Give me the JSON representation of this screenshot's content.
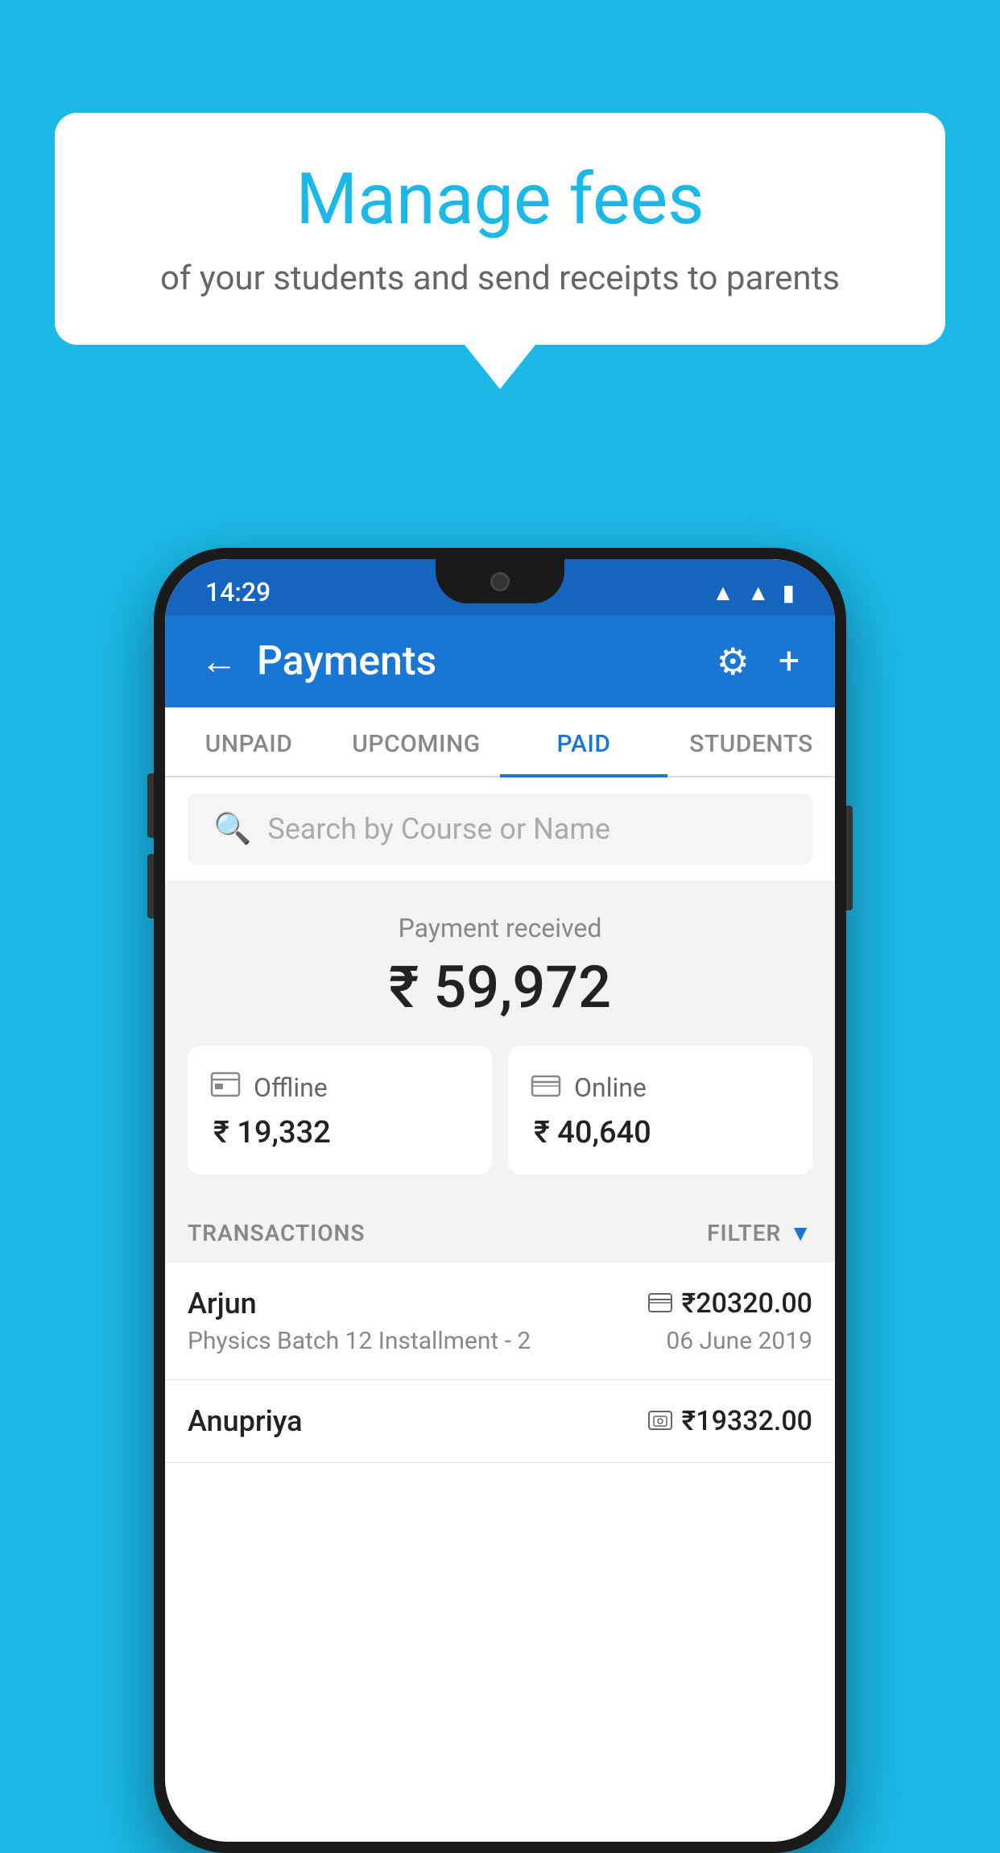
{
  "background_color": "#1BB8E8",
  "speech_bubble": {
    "title": "Manage fees",
    "subtitle": "of your students and send receipts to parents"
  },
  "status_bar": {
    "time": "14:29",
    "wifi_icon": "▲",
    "signal_icon": "▲",
    "battery_icon": "▮"
  },
  "app_bar": {
    "title": "Payments",
    "back_label": "←",
    "settings_label": "⚙",
    "add_label": "+"
  },
  "tabs": [
    {
      "id": "unpaid",
      "label": "UNPAID",
      "active": false
    },
    {
      "id": "upcoming",
      "label": "UPCOMING",
      "active": false
    },
    {
      "id": "paid",
      "label": "PAID",
      "active": true
    },
    {
      "id": "students",
      "label": "STUDENTS",
      "active": false
    }
  ],
  "search": {
    "placeholder": "Search by Course or Name"
  },
  "payment_summary": {
    "label": "Payment received",
    "total": "₹ 59,972",
    "offline": {
      "label": "Offline",
      "amount": "₹ 19,332",
      "icon": "💳"
    },
    "online": {
      "label": "Online",
      "amount": "₹ 40,640",
      "icon": "💳"
    }
  },
  "transactions": {
    "label": "TRANSACTIONS",
    "filter_label": "FILTER",
    "items": [
      {
        "name": "Arjun",
        "course": "Physics Batch 12 Installment - 2",
        "amount": "₹20320.00",
        "date": "06 June 2019",
        "payment_type": "card"
      },
      {
        "name": "Anupriya",
        "course": "",
        "amount": "₹19332.00",
        "date": "",
        "payment_type": "cash"
      }
    ]
  }
}
